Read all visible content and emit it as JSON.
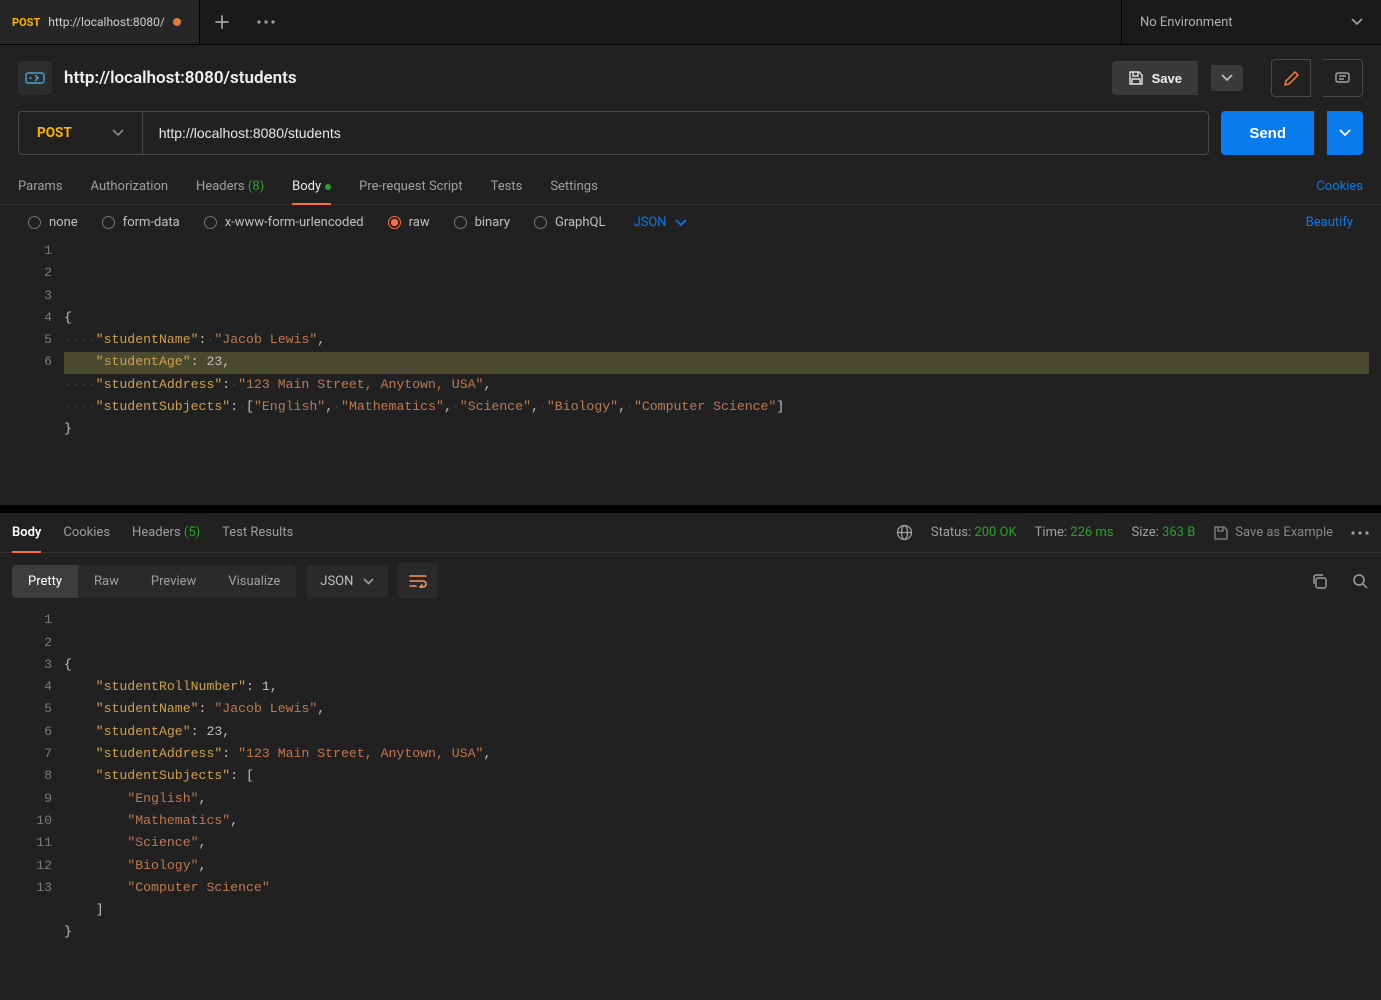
{
  "tab": {
    "method": "POST",
    "title": "http://localhost:8080/"
  },
  "env": {
    "label": "No Environment"
  },
  "title": "http://localhost:8080/students",
  "save_label": "Save",
  "method": "POST",
  "url": "http://localhost:8080/students",
  "send_label": "Send",
  "req_tabs": {
    "params": "Params",
    "authorization": "Authorization",
    "headers_label": "Headers",
    "headers_count": "(8)",
    "body": "Body",
    "prerequest": "Pre-request Script",
    "tests": "Tests",
    "settings": "Settings"
  },
  "cookies_link": "Cookies",
  "body_types": {
    "none": "none",
    "formdata": "form-data",
    "xwww": "x-www-form-urlencoded",
    "raw": "raw",
    "binary": "binary",
    "graphql": "GraphQL"
  },
  "raw_format": "JSON",
  "beautify": "Beautify",
  "request_body": {
    "studentName": "Jacob Lewis",
    "studentAge": 23,
    "studentAddress": "123 Main Street, Anytown, USA",
    "studentSubjects": [
      "English",
      "Mathematics",
      "Science",
      "Biology",
      "Computer Science"
    ]
  },
  "request_editor_lines": [
    "1",
    "2",
    "3",
    "4",
    "5",
    "6"
  ],
  "resp_tabs": {
    "body": "Body",
    "cookies": "Cookies",
    "headers_label": "Headers",
    "headers_count": "(5)",
    "test_results": "Test Results"
  },
  "resp_meta": {
    "status_label": "Status:",
    "status_val": "200 OK",
    "time_label": "Time:",
    "time_val": "226 ms",
    "size_label": "Size:",
    "size_val": "363 B",
    "save_example": "Save as Example"
  },
  "resp_view": {
    "pretty": "Pretty",
    "raw": "Raw",
    "preview": "Preview",
    "visualize": "Visualize",
    "format": "JSON"
  },
  "response_body": {
    "studentRollNumber": 1,
    "studentName": "Jacob Lewis",
    "studentAge": 23,
    "studentAddress": "123 Main Street, Anytown, USA",
    "studentSubjects": [
      "English",
      "Mathematics",
      "Science",
      "Biology",
      "Computer Science"
    ]
  },
  "response_editor_lines": [
    "1",
    "2",
    "3",
    "4",
    "5",
    "6",
    "7",
    "8",
    "9",
    "10",
    "11",
    "12",
    "13"
  ]
}
